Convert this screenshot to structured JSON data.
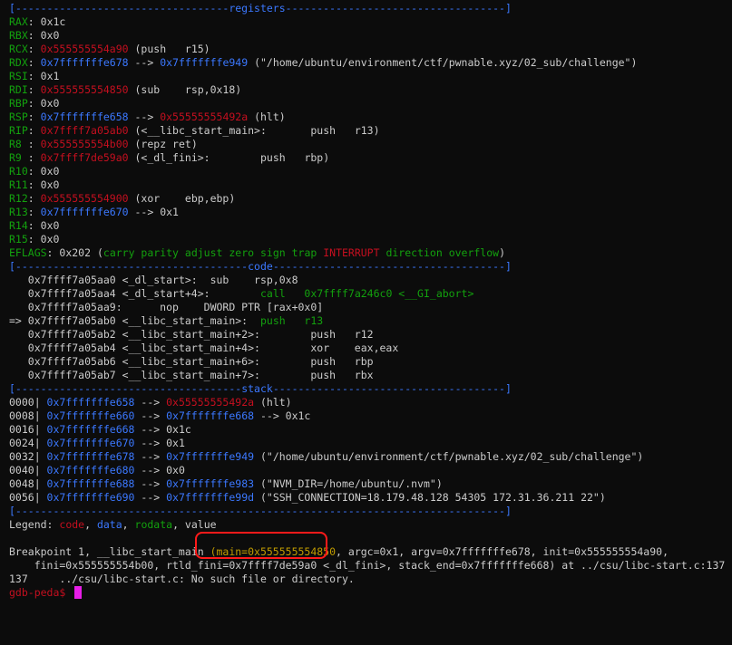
{
  "colors": {
    "background": "#0c0c0c",
    "green": "#13a10e",
    "red": "#c50f1f",
    "blue": "#3b78ff",
    "white": "#cccccc",
    "yellow": "#c19c00",
    "magenta": "#b4009e",
    "cursor": "#e81ee8",
    "annotation": "#ff1a1a"
  },
  "registers": {
    "separator_left": "[----------------------------------",
    "title": "registers",
    "separator_right": "-----------------------------------]",
    "rax": {
      "name": "RAX",
      "sep": ": ",
      "value": "0x1c"
    },
    "rbx": {
      "name": "RBX",
      "sep": ": ",
      "value": "0x0"
    },
    "rcx": {
      "name": "RCX",
      "sep": ": ",
      "value": "0x555555554a90",
      "detail": " (push   r15)"
    },
    "rdx": {
      "name": "RDX",
      "sep": ": ",
      "value": "0x7fffffffe678",
      "arrow": " --> ",
      "target": "0x7fffffffe949",
      "detail": " (\"/home/ubuntu/environment/ctf/pwnable.xyz/02_sub/challenge\")"
    },
    "rsi": {
      "name": "RSI",
      "sep": ": ",
      "value": "0x1"
    },
    "rdi": {
      "name": "RDI",
      "sep": ": ",
      "value": "0x555555554850",
      "detail": " (sub    rsp,0x18)"
    },
    "rbp": {
      "name": "RBP",
      "sep": ": ",
      "value": "0x0"
    },
    "rsp": {
      "name": "RSP",
      "sep": ": ",
      "value": "0x7fffffffe658",
      "arrow": " --> ",
      "target": "0x55555555492a",
      "detail": " (hlt)"
    },
    "rip": {
      "name": "RIP",
      "sep": ": ",
      "value": "0x7ffff7a05ab0",
      "detail": " (<__libc_start_main>:       push   r13)"
    },
    "r8": {
      "name": "R8 ",
      "sep": ": ",
      "value": "0x555555554b00",
      "detail": " (repz ret)"
    },
    "r9": {
      "name": "R9 ",
      "sep": ": ",
      "value": "0x7ffff7de59a0",
      "detail": " (<_dl_fini>:        push   rbp)"
    },
    "r10": {
      "name": "R10",
      "sep": ": ",
      "value": "0x0"
    },
    "r11": {
      "name": "R11",
      "sep": ": ",
      "value": "0x0"
    },
    "r12": {
      "name": "R12",
      "sep": ": ",
      "value": "0x555555554900",
      "detail": " (xor    ebp,ebp)"
    },
    "r13": {
      "name": "R13",
      "sep": ": ",
      "value": "0x7fffffffe670",
      "arrow": " --> ",
      "target": "0x1"
    },
    "r14": {
      "name": "R14",
      "sep": ": ",
      "value": "0x0"
    },
    "r15": {
      "name": "R15",
      "sep": ": ",
      "value": "0x0"
    },
    "eflags": {
      "name": "EFLAGS",
      "sep": ": ",
      "value": "0x202",
      "open": " (",
      "flags_pre": "carry parity adjust zero sign trap ",
      "flag_set": "INTERRUPT",
      "flags_post": " direction overflow",
      "close": ")"
    }
  },
  "code": {
    "separator_left": "[-------------------------------------",
    "title": "code",
    "separator_right": "-------------------------------------]",
    "lines": [
      {
        "prefix": "   ",
        "text": "0x7ffff7a05aa0 <_dl_start>:  sub    rsp,0x8"
      },
      {
        "prefix": "   ",
        "text": "0x7ffff7a05aa4 <_dl_start+4>:        ",
        "hl": "call   0x7ffff7a246c0 <__GI_abort>"
      },
      {
        "prefix": "   ",
        "text": "0x7ffff7a05aa9:      nop    DWORD PTR [rax+0x0]"
      },
      {
        "prefix": "=> ",
        "text": "0x7ffff7a05ab0 <__libc_start_main>:  ",
        "hl": "push   r13"
      },
      {
        "prefix": "   ",
        "text": "0x7ffff7a05ab2 <__libc_start_main+2>:        push   r12"
      },
      {
        "prefix": "   ",
        "text": "0x7ffff7a05ab4 <__libc_start_main+4>:        xor    eax,eax"
      },
      {
        "prefix": "   ",
        "text": "0x7ffff7a05ab6 <__libc_start_main+6>:        push   rbp"
      },
      {
        "prefix": "   ",
        "text": "0x7ffff7a05ab7 <__libc_start_main+7>:        push   rbx"
      }
    ]
  },
  "stack": {
    "separator_left": "[------------------------------------",
    "title": "stack",
    "separator_right": "-------------------------------------]",
    "rows": [
      {
        "off": "0000|",
        "addr": " 0x7fffffffe658",
        "arrow": " --> ",
        "target": "0x55555555492a",
        "detail": " (hlt)"
      },
      {
        "off": "0008|",
        "addr": " 0x7fffffffe660",
        "arrow": " --> ",
        "target": "0x7fffffffe668",
        "detail": " --> 0x1c"
      },
      {
        "off": "0016|",
        "addr": " 0x7fffffffe668",
        "arrow": " --> ",
        "value": "0x1c"
      },
      {
        "off": "0024|",
        "addr": " 0x7fffffffe670",
        "arrow": " --> ",
        "value": "0x1"
      },
      {
        "off": "0032|",
        "addr": " 0x7fffffffe678",
        "arrow": " --> ",
        "target": "0x7fffffffe949",
        "detail": " (\"/home/ubuntu/environment/ctf/pwnable.xyz/02_sub/challenge\")"
      },
      {
        "off": "0040|",
        "addr": " 0x7fffffffe680",
        "arrow": " --> ",
        "value": "0x0"
      },
      {
        "off": "0048|",
        "addr": " 0x7fffffffe688",
        "arrow": " --> ",
        "target": "0x7fffffffe983",
        "detail": " (\"NVM_DIR=/home/ubuntu/.nvm\")"
      },
      {
        "off": "0056|",
        "addr": " 0x7fffffffe690",
        "arrow": " --> ",
        "target": "0x7fffffffe99d",
        "detail": " (\"SSH_CONNECTION=18.179.48.128 54305 172.31.36.211 22\")"
      }
    ],
    "separator_bottom": "[------------------------------------------------------------------------------]"
  },
  "legend": {
    "label": "Legend: ",
    "code": "code",
    "sep1": ", ",
    "data": "data",
    "sep2": ", ",
    "rodata": "rodata",
    "sep3": ", ",
    "value": "value"
  },
  "breakpoint": {
    "line1_pre": "Breakpoint 1, __libc_start_main ",
    "main_arg": "(main=0x555555554850",
    "line1_post": ", argc=0x1, argv=0x7fffffffe678, init=0x555555554a90,",
    "line2": "    fini=0x555555554b00, rtld_fini=0x7ffff7de59a0 <_dl_fini>, stack_end=0x7fffffffe668) at ../csu/libc-start.c:137",
    "line3": "137\t../csu/libc-start.c: No such file or directory."
  },
  "prompt": {
    "text": "gdb-peda$ ",
    "input": ""
  }
}
